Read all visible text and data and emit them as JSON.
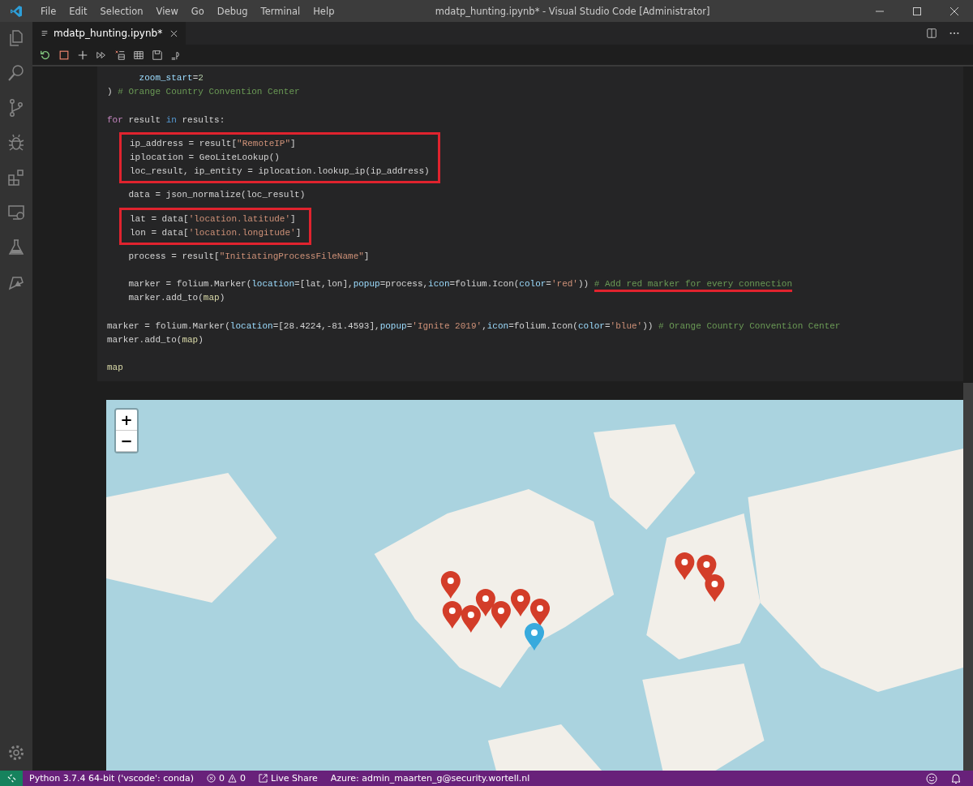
{
  "window": {
    "title": "mdatp_hunting.ipynb* - Visual Studio Code [Administrator]"
  },
  "menu": [
    "File",
    "Edit",
    "Selection",
    "View",
    "Go",
    "Debug",
    "Terminal",
    "Help"
  ],
  "tabs": [
    {
      "label": "mdatp_hunting.ipynb*",
      "selected": true
    }
  ],
  "code": {
    "blocks": [
      {
        "boxed": false,
        "spaced": false,
        "lines": [
          [
            {
              "t": "      zoom_start",
              "kind": "param"
            },
            {
              "t": "=",
              "kind": "plain"
            },
            {
              "t": "2",
              "kind": "num"
            }
          ],
          [
            {
              "t": ") ",
              "kind": "plain"
            },
            {
              "t": "# Orange Country Convention Center",
              "kind": "comment"
            }
          ]
        ]
      },
      {
        "boxed": false,
        "spaced": true,
        "lines": [
          [
            {
              "t": "for",
              "kind": "ctrl"
            },
            {
              "t": " result ",
              "kind": "plain"
            },
            {
              "t": "in",
              "kind": "kw"
            },
            {
              "t": " results:",
              "kind": "plain"
            }
          ]
        ]
      },
      {
        "boxed": true,
        "spaced": false,
        "lines": [
          [
            {
              "t": "ip_address = result[",
              "kind": "plain"
            },
            {
              "t": "\"RemoteIP\"",
              "kind": "str"
            },
            {
              "t": "]",
              "kind": "plain"
            }
          ],
          [
            {
              "t": "iplocation = GeoLiteLookup()",
              "kind": "plain"
            }
          ],
          [
            {
              "t": "loc_result, ip_entity = iplocation.lookup_ip(ip_address)",
              "kind": "plain"
            }
          ]
        ]
      },
      {
        "boxed": false,
        "spaced": false,
        "lines": [
          [
            {
              "t": "    data = json_normalize(loc_result)",
              "kind": "plain"
            }
          ]
        ]
      },
      {
        "boxed": true,
        "spaced": false,
        "lines": [
          [
            {
              "t": "lat = data[",
              "kind": "plain"
            },
            {
              "t": "'location.latitude'",
              "kind": "str"
            },
            {
              "t": "]",
              "kind": "plain"
            }
          ],
          [
            {
              "t": "lon = data[",
              "kind": "plain"
            },
            {
              "t": "'location.longitude'",
              "kind": "str"
            },
            {
              "t": "]",
              "kind": "plain"
            }
          ]
        ]
      },
      {
        "boxed": false,
        "spaced": false,
        "lines": [
          [
            {
              "t": "    process = result[",
              "kind": "plain"
            },
            {
              "t": "\"InitiatingProcessFileName\"",
              "kind": "str"
            },
            {
              "t": "]",
              "kind": "plain"
            }
          ]
        ]
      },
      {
        "boxed": false,
        "spaced": true,
        "lines": [
          [
            {
              "t": "    marker = folium.Marker(",
              "kind": "plain"
            },
            {
              "t": "location",
              "kind": "param"
            },
            {
              "t": "=[lat,lon],",
              "kind": "plain"
            },
            {
              "t": "popup",
              "kind": "param"
            },
            {
              "t": "=process,",
              "kind": "plain"
            },
            {
              "t": "icon",
              "kind": "param"
            },
            {
              "t": "=folium.Icon(",
              "kind": "plain"
            },
            {
              "t": "color",
              "kind": "param"
            },
            {
              "t": "=",
              "kind": "plain"
            },
            {
              "t": "'red'",
              "kind": "str"
            },
            {
              "t": ")) ",
              "kind": "plain"
            },
            {
              "t": "# Add red marker for every connection",
              "kind": "comment",
              "underlined": true
            }
          ],
          [
            {
              "t": "    marker.add_to(",
              "kind": "plain"
            },
            {
              "t": "map",
              "kind": "fn"
            },
            {
              "t": ")",
              "kind": "plain"
            }
          ]
        ]
      },
      {
        "boxed": false,
        "spaced": true,
        "lines": [
          [
            {
              "t": "marker = folium.Marker(",
              "kind": "plain"
            },
            {
              "t": "location",
              "kind": "param"
            },
            {
              "t": "=[28.4224,-81.4593],",
              "kind": "plain"
            },
            {
              "t": "popup",
              "kind": "param"
            },
            {
              "t": "=",
              "kind": "plain"
            },
            {
              "t": "'Ignite 2019'",
              "kind": "str"
            },
            {
              "t": ",",
              "kind": "plain"
            },
            {
              "t": "icon",
              "kind": "param"
            },
            {
              "t": "=folium.Icon(",
              "kind": "plain"
            },
            {
              "t": "color",
              "kind": "param"
            },
            {
              "t": "=",
              "kind": "plain"
            },
            {
              "t": "'blue'",
              "kind": "str"
            },
            {
              "t": ")) ",
              "kind": "plain"
            },
            {
              "t": "# Orange Country Convention Center",
              "kind": "comment"
            }
          ],
          [
            {
              "t": "marker.add_to(",
              "kind": "plain"
            },
            {
              "t": "map",
              "kind": "fn"
            },
            {
              "t": ")",
              "kind": "plain"
            }
          ]
        ]
      },
      {
        "boxed": false,
        "spaced": true,
        "lines": [
          [
            {
              "t": "map",
              "kind": "fn"
            }
          ]
        ]
      }
    ]
  },
  "map": {
    "kind": "picture",
    "zoom_in": "+",
    "zoom_out": "−"
  },
  "status_bar": {
    "interpreter": "Python 3.7.4 64-bit ('vscode': conda)",
    "errors": "0",
    "warnings": "0",
    "live_share": "Live Share",
    "azure": "Azure: admin_maarten_g@security.wortell.nl"
  }
}
